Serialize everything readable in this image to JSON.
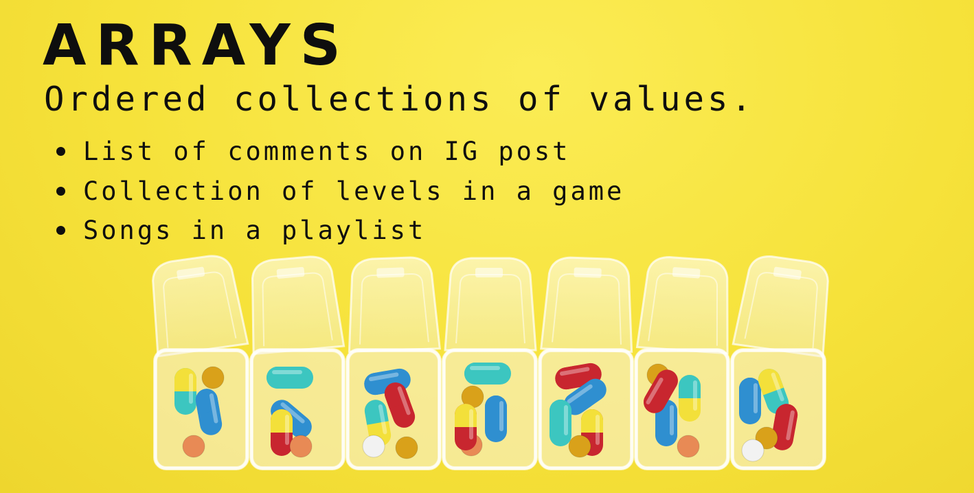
{
  "slide": {
    "title": "ARRAYS",
    "subtitle": "Ordered collections of values.",
    "bullets": [
      "List of comments on IG post",
      "Collection of levels in a game",
      "Songs in a playlist"
    ]
  },
  "image": {
    "subject": "seven-compartment pill organizer",
    "compartments": 7,
    "colors": {
      "background": "#f6e23c",
      "text": "#0e0e0e",
      "pill_blue": "#2f8fd0",
      "pill_teal": "#3cc6c0",
      "pill_yellow": "#f3e03a",
      "pill_red": "#c8262f",
      "pill_orange": "#e88a55",
      "pill_amber": "#d9a11a",
      "pill_white": "#f2f2f2"
    }
  }
}
